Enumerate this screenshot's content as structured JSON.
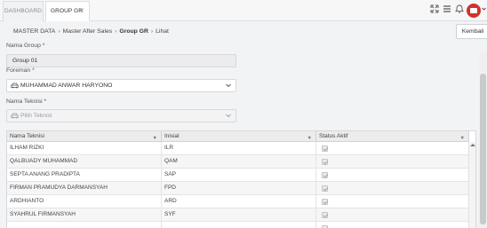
{
  "tabs": [
    {
      "label": "DASHBOARD",
      "active": false
    },
    {
      "label": "GROUP GR",
      "active": true
    }
  ],
  "breadcrumb": [
    "MASTER DATA",
    "Master After Sales",
    "Group GR",
    "Lihat"
  ],
  "back_button": "Kembali",
  "form": {
    "group_label": "Nama Group *",
    "group_value": "Group 01",
    "foreman_label": "Foreman *",
    "foreman_value": "MUHAMMAD ANWAR HARYONO",
    "teknisi_label": "Nama Teknisi *",
    "teknisi_placeholder": "Pilih Teknisi"
  },
  "table": {
    "columns": [
      "Nama Teknisi",
      "Inisial",
      "Status Aktif"
    ],
    "rows": [
      {
        "nama": "ILHAM RIZKI",
        "inisial": "ILR",
        "aktif": true
      },
      {
        "nama": "QALBUADY MUHAMMAD",
        "inisial": "QAM",
        "aktif": true
      },
      {
        "nama": "SEPTA ANANG PRADIPTA",
        "inisial": "SAP",
        "aktif": true
      },
      {
        "nama": "FIRMAN PRAMUDYA DARMANSYAH",
        "inisial": "FPD",
        "aktif": true
      },
      {
        "nama": "ARDHIANTO",
        "inisial": "ARD",
        "aktif": true
      },
      {
        "nama": "SYAHRUL FIRMANSYAH",
        "inisial": "SYF",
        "aktif": true
      },
      {
        "nama": "",
        "inisial": "",
        "aktif": true
      }
    ]
  },
  "icons": [
    "close-icon",
    "expand-icon",
    "menu-icon",
    "bell-icon",
    "user-avatar",
    "chevron-down-icon",
    "car-icon",
    "filter-icon",
    "checkbox"
  ],
  "colors": {
    "accent": "#d0332c"
  }
}
